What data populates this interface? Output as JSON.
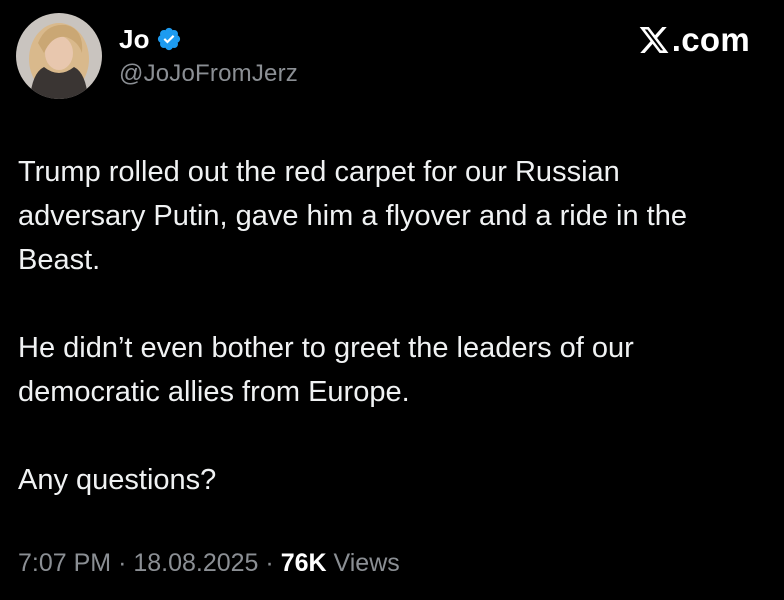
{
  "brand": {
    "logo_icon": "x-logo-icon",
    "suffix": ".com"
  },
  "author": {
    "display_name": "Jo",
    "handle": "@JoJoFromJerz",
    "verified_icon": "verified-badge-icon",
    "verified_color": "#1d9bf0"
  },
  "tweet": {
    "paragraphs": [
      "Trump rolled out the red carpet for our Russian\nadversary Putin, gave him a flyover and a ride in the\nBeast.",
      "He didn’t even bother to greet the leaders of our\ndemocratic allies from Europe.",
      "Any questions?"
    ]
  },
  "meta": {
    "time": "7:07 PM",
    "separator": "·",
    "date": "18.08.2025",
    "views_count": "76K",
    "views_label": "Views"
  },
  "colors": {
    "background": "#000000",
    "text": "#e7e9ea",
    "muted": "#8b8f94"
  }
}
